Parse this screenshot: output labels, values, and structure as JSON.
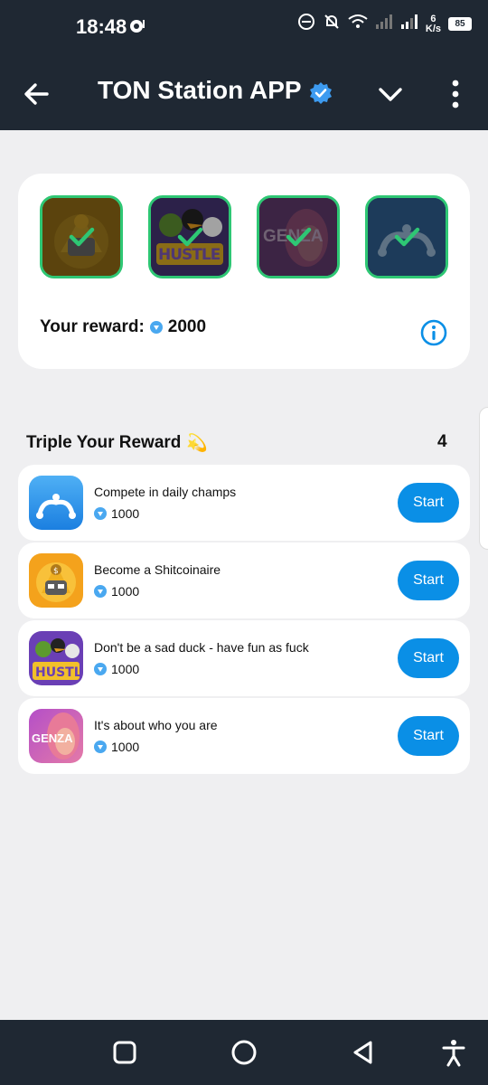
{
  "status_bar": {
    "time": "18:48",
    "speed_value": "6",
    "speed_unit": "K/s",
    "battery": "85"
  },
  "app_bar": {
    "title": "TON Station APP"
  },
  "reward_card": {
    "label": "Your reward:",
    "amount": "2000",
    "games": [
      {
        "name": "shitcoinaire-thumb",
        "text": ""
      },
      {
        "name": "hustle-thumb",
        "text": "HUSTLE"
      },
      {
        "name": "genza-thumb",
        "text": "GENZA"
      },
      {
        "name": "champs-thumb",
        "text": ""
      }
    ]
  },
  "tasks_section": {
    "title": "Triple Your Reward",
    "emoji": "💫",
    "count": "4",
    "tasks": [
      {
        "title": "Compete in daily champs",
        "reward": "1000",
        "button": "Start"
      },
      {
        "title": "Become a Shitcoinaire",
        "reward": "1000",
        "button": "Start"
      },
      {
        "title": "Don't be a sad duck - have fun as fuck",
        "reward": "1000",
        "button": "Start"
      },
      {
        "title": "It's about who you are",
        "reward": "1000",
        "button": "Start"
      }
    ]
  },
  "colors": {
    "header_bg": "#1f2833",
    "accent": "#0a8fe6",
    "check_green": "#2ec774",
    "page_bg": "#efeff1"
  }
}
